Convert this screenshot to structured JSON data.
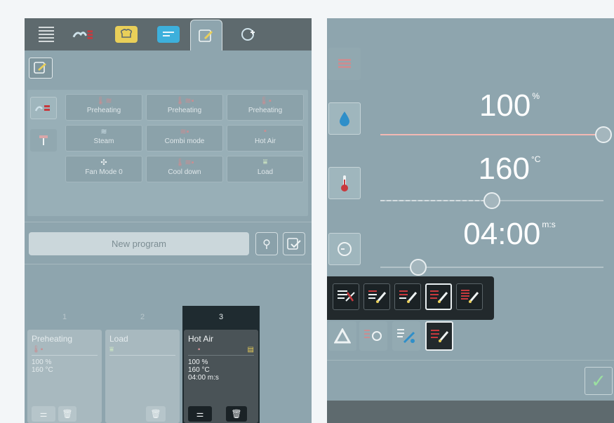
{
  "left": {
    "tabs": [
      {
        "icon": "menu-icon"
      },
      {
        "icon": "cooking-categories-icon"
      },
      {
        "icon": "chef-hat-icon"
      },
      {
        "icon": "program-list-icon"
      },
      {
        "icon": "edit-program-icon",
        "active": true
      },
      {
        "icon": "add-cycle-icon"
      }
    ],
    "category_buttons": [
      {
        "icon": "steam-heat-category-icon",
        "active": true
      },
      {
        "icon": "tool-category-icon"
      }
    ],
    "step_tiles": [
      {
        "label": "Preheating",
        "icon": "thermometer-steam-icon"
      },
      {
        "label": "Preheating",
        "icon": "thermometer-combi-icon"
      },
      {
        "label": "Preheating",
        "icon": "thermometer-hotair-icon"
      },
      {
        "label": "Steam",
        "icon": "steam-icon"
      },
      {
        "label": "Combi mode",
        "icon": "combi-mode-icon"
      },
      {
        "label": "Hot Air",
        "icon": "hot-air-icon"
      },
      {
        "label": "Fan Mode 0",
        "icon": "fan-icon"
      },
      {
        "label": "Cool down",
        "icon": "cool-down-icon"
      },
      {
        "label": "Load",
        "icon": "load-icon"
      }
    ],
    "program_name_placeholder": "New program",
    "step_columns": [
      {
        "number": "1",
        "title": "Preheating",
        "values": [
          "100 %",
          "160 °C"
        ],
        "selected": false
      },
      {
        "number": "2",
        "title": "Load",
        "values": [],
        "selected": false
      },
      {
        "number": "3",
        "title": "Hot Air",
        "values": [
          "100 %",
          "160 °C",
          "04:00 m:s"
        ],
        "selected": true
      }
    ]
  },
  "right": {
    "humidity": {
      "value": "100",
      "unit": "%",
      "level": 1.0
    },
    "temperature": {
      "value": "160",
      "unit": "°C",
      "level": 0.5
    },
    "time": {
      "value": "04:00",
      "unit": "m:s",
      "level": 0.17
    },
    "fan_speed_options": 5,
    "fan_speed_selected": 4,
    "colors": {
      "accent_red": "#c8393d",
      "panel": "#8ea5ae",
      "dark_popup": "#22292c",
      "check_green": "#9be0a0",
      "humidity_track": "#f2b9b4"
    }
  }
}
